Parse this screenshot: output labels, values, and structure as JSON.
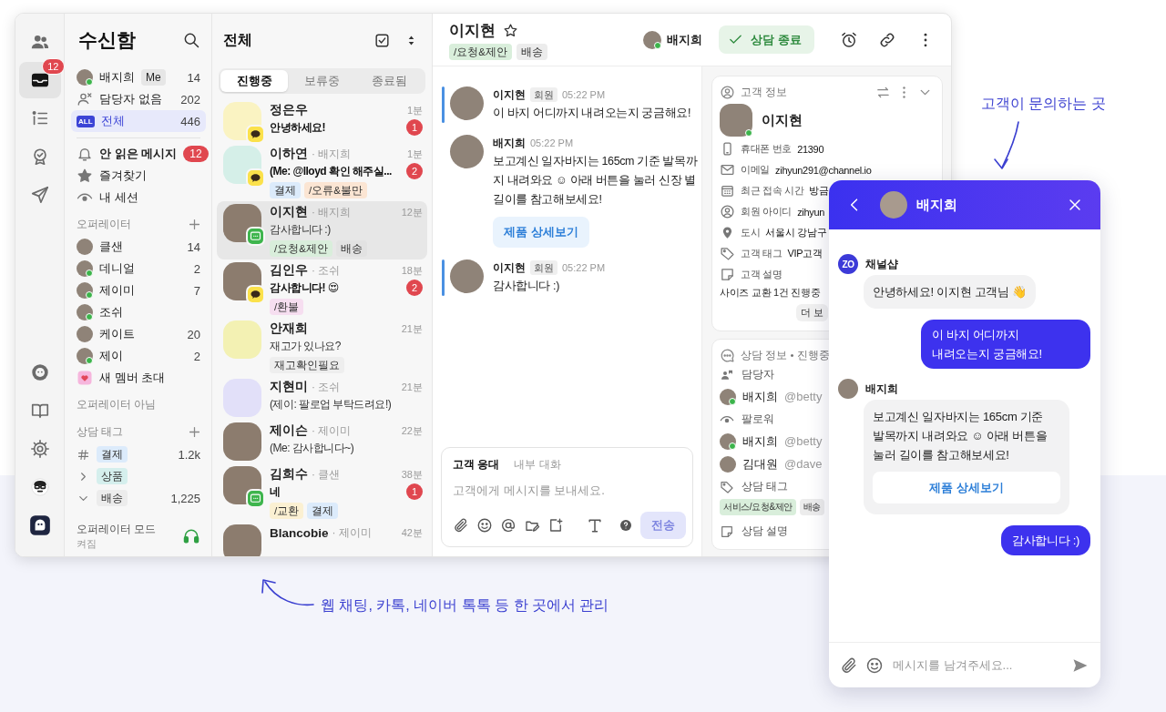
{
  "rail": {
    "top": [
      {
        "kind": "people",
        "selected": false
      },
      {
        "kind": "inbox",
        "selected": true,
        "badge": "12"
      },
      {
        "kind": "list",
        "selected": false
      },
      {
        "kind": "award",
        "selected": false
      },
      {
        "kind": "send",
        "selected": false
      }
    ],
    "bottom": [
      {
        "kind": "bot"
      },
      {
        "kind": "book"
      },
      {
        "kind": "gear"
      },
      {
        "kind": "face"
      },
      {
        "kind": "app"
      }
    ]
  },
  "sidebar": {
    "title": "수신함",
    "inboxes": [
      {
        "kind": "me",
        "label": "배지희",
        "tag": "Me",
        "count": "14",
        "online": true,
        "selected": false
      },
      {
        "kind": "unassigned",
        "label": "담당자 없음",
        "count": "202",
        "selected": false
      },
      {
        "kind": "all",
        "icon_text": "ALL",
        "label": "전체",
        "count": "446",
        "selected": true
      }
    ],
    "filters": [
      {
        "kind": "bell",
        "label": "안 읽은 메시지",
        "badge": "12"
      },
      {
        "kind": "star",
        "label": "즐겨찾기"
      },
      {
        "kind": "eye",
        "label": "내 세션"
      }
    ],
    "operators_title": "오퍼레이터",
    "operators": [
      {
        "name": "클샌",
        "count": "14",
        "online": false
      },
      {
        "name": "데니얼",
        "count": "2",
        "online": true
      },
      {
        "name": "제이미",
        "count": "7",
        "online": true
      },
      {
        "name": "조쉬",
        "online": true
      },
      {
        "name": "케이트",
        "count": "20",
        "online": false
      },
      {
        "name": "제이",
        "count": "2",
        "online": true
      }
    ],
    "invite": "새 멤버 초대",
    "non_operators_title": "오퍼레이터 아님",
    "tags_title": "상담 태그",
    "tags": [
      {
        "kind": "hash",
        "label": "결제",
        "count": "1.2k",
        "color": "#dcebfb"
      },
      {
        "kind": "collapsed",
        "label": "상품",
        "color": "#d5efed"
      },
      {
        "kind": "expanded",
        "label": "배송",
        "count": "1,225",
        "color": "#ececec"
      }
    ],
    "mode": {
      "title": "오퍼레이터 모드",
      "status": "켜짐",
      "on": true
    }
  },
  "conversations": {
    "title": "전체",
    "tabs": [
      {
        "label": "진행중",
        "selected": true
      },
      {
        "label": "보류중",
        "selected": false
      },
      {
        "label": "종료됨",
        "selected": false
      }
    ],
    "items": [
      {
        "name": "정은우",
        "time": "1분",
        "message": "안녕하세요!",
        "unread": "1",
        "channel": {
          "kind": "kakao"
        },
        "color": "#faf3c2",
        "selected": false
      },
      {
        "name": "이하연",
        "assignee": "· 배지희",
        "time": "1분",
        "message": "(Me: @lloyd 확인 해주실...",
        "unread": "2",
        "channel": {
          "kind": "kakao"
        },
        "color": "#d5efe8",
        "tags": [
          {
            "label": "결제",
            "color": "#dcebfb"
          },
          {
            "label": "/오류&불만",
            "color": "#fbe5d3"
          }
        ],
        "selected": false
      },
      {
        "name": "이지현",
        "assignee": "· 배지희",
        "time": "12분",
        "message": "감사합니다 :)",
        "channel": {
          "kind": "web"
        },
        "tags": [
          {
            "label": "/요청&제안",
            "color": "#d9eedb"
          },
          {
            "label": "배송",
            "color": "#e2e2e2"
          }
        ],
        "selected": true
      },
      {
        "name": "김인우",
        "assignee": "· 조쉬",
        "time": "18분",
        "message": "감사합니다! 😍",
        "unread": "2",
        "channel": {
          "kind": "kakao"
        },
        "tags": [
          {
            "label": "/환불",
            "color": "#f6def0"
          }
        ],
        "selected": false
      },
      {
        "name": "안재희",
        "time": "21분",
        "message": "재고가 있나요?",
        "color": "#f3f1b3",
        "tags": [
          {
            "label": "재고확인필요",
            "color": "#eeeeee"
          }
        ],
        "selected": false
      },
      {
        "name": "지현미",
        "assignee": "· 조쉬",
        "time": "21분",
        "message": "(제이: 팔로업 부탁드려요!)",
        "color": "#e2e0f9",
        "selected": false
      },
      {
        "name": "제이슨",
        "assignee": "· 제이미",
        "time": "22분",
        "message": "(Me: 감사합니다~)",
        "selected": false
      },
      {
        "name": "김희수",
        "assignee": "· 클샌",
        "time": "38분",
        "message": "네",
        "unread": "1",
        "channel": {
          "kind": "web"
        },
        "tags": [
          {
            "label": "/교환",
            "color": "#fbf0d2"
          },
          {
            "label": "결제",
            "color": "#dcebfb"
          }
        ],
        "selected": false
      },
      {
        "name": "Blancobie",
        "assignee": "· 제이미",
        "time": "42분",
        "selected": false
      }
    ]
  },
  "chat": {
    "name": "이지현",
    "starred": false,
    "tags": [
      {
        "label": "/요청&제안",
        "color": "#d9eedb"
      },
      {
        "label": "배송",
        "color": "#ececec"
      }
    ],
    "assignee": "배지희",
    "assignee_online": true,
    "close_button": "상담 종료",
    "messages": [
      {
        "kind": "customer",
        "author": "이지현",
        "role": "회원",
        "time": "05:22 PM",
        "text": "이 바지 어디까지 내려오는지 궁금해요!"
      },
      {
        "kind": "agent",
        "author": "배지희",
        "time": "05:22 PM",
        "text": "보고계신 일자바지는 165cm 기준 발목까지 내려와요 ☺ 아래 버튼을 눌러 신장 별 길이를 참고해보세요!",
        "button": "제품 상세보기"
      },
      {
        "kind": "customer",
        "author": "이지현",
        "role": "회원",
        "time": "05:22 PM",
        "text": "감사합니다 :)"
      }
    ],
    "composer": {
      "tabs": [
        {
          "label": "고객 응대",
          "selected": true
        },
        {
          "label": "내부 대화",
          "selected": false
        }
      ],
      "placeholder": "고객에게 메시지를 보내세요.",
      "send": "전송",
      "send_disabled": true
    }
  },
  "customer_info": {
    "title": "고객 정보",
    "name": "이지현",
    "online": true,
    "fields": [
      {
        "kind": "phone",
        "label": "휴대폰 번호",
        "value": "21390"
      },
      {
        "kind": "mail",
        "label": "이메일",
        "value": "zihyun291@channel.io"
      },
      {
        "kind": "calendar",
        "label": "최근 접속 시간",
        "value": "방금"
      },
      {
        "kind": "person",
        "label": "회원 아이디",
        "value": "zihyun"
      },
      {
        "kind": "pin",
        "label": "도시",
        "value": "서울시 강남구"
      },
      {
        "kind": "tag",
        "label": "고객 태그",
        "value": "VIP고객"
      },
      {
        "kind": "note",
        "label": "고객 설명"
      }
    ],
    "description": "사이즈 교환 1건 진행중",
    "more": "더 보"
  },
  "session_info": {
    "title": "상담 정보 • 진행중",
    "assignee_label": "담당자",
    "assignees": [
      {
        "name": "배지희",
        "handle": "@betty",
        "online": true
      }
    ],
    "followers_label": "팔로워",
    "followers": [
      {
        "name": "배지희",
        "handle": "@betty",
        "online": true
      },
      {
        "name": "김대원",
        "handle": "@dave",
        "online": false
      }
    ],
    "tags_label": "상담 태그",
    "tags": [
      {
        "label": "서비스/요청&제안",
        "color": "#d9eedb"
      },
      {
        "label": "배송",
        "color": "#ececec"
      }
    ],
    "description_label": "상담 설명"
  },
  "widget": {
    "agent": "배지희",
    "messages": [
      {
        "kind": "bot",
        "author": "채널샵",
        "logo": "ZO",
        "text": "안녕하세요! 이지현 고객님 👋"
      },
      {
        "kind": "user",
        "text": "이 바지 어디까지 내려오는지 궁금해요!"
      },
      {
        "kind": "agent",
        "author": "배지희",
        "text": "보고계신 일자바지는 165cm 기준 발목까지 내려와요 ☺ 아래 버튼을 눌러 길이를 참고해보세요!",
        "button": "제품 상세보기"
      },
      {
        "kind": "user",
        "text": "감사합니다 :)"
      }
    ],
    "placeholder": "메시지를 남겨주세요..."
  },
  "annotations": [
    {
      "text": "고객이 문의하는 곳"
    },
    {
      "text": "웹 채팅, 카톡, 네이버 톡톡 등 한 곳에서 관리"
    }
  ]
}
